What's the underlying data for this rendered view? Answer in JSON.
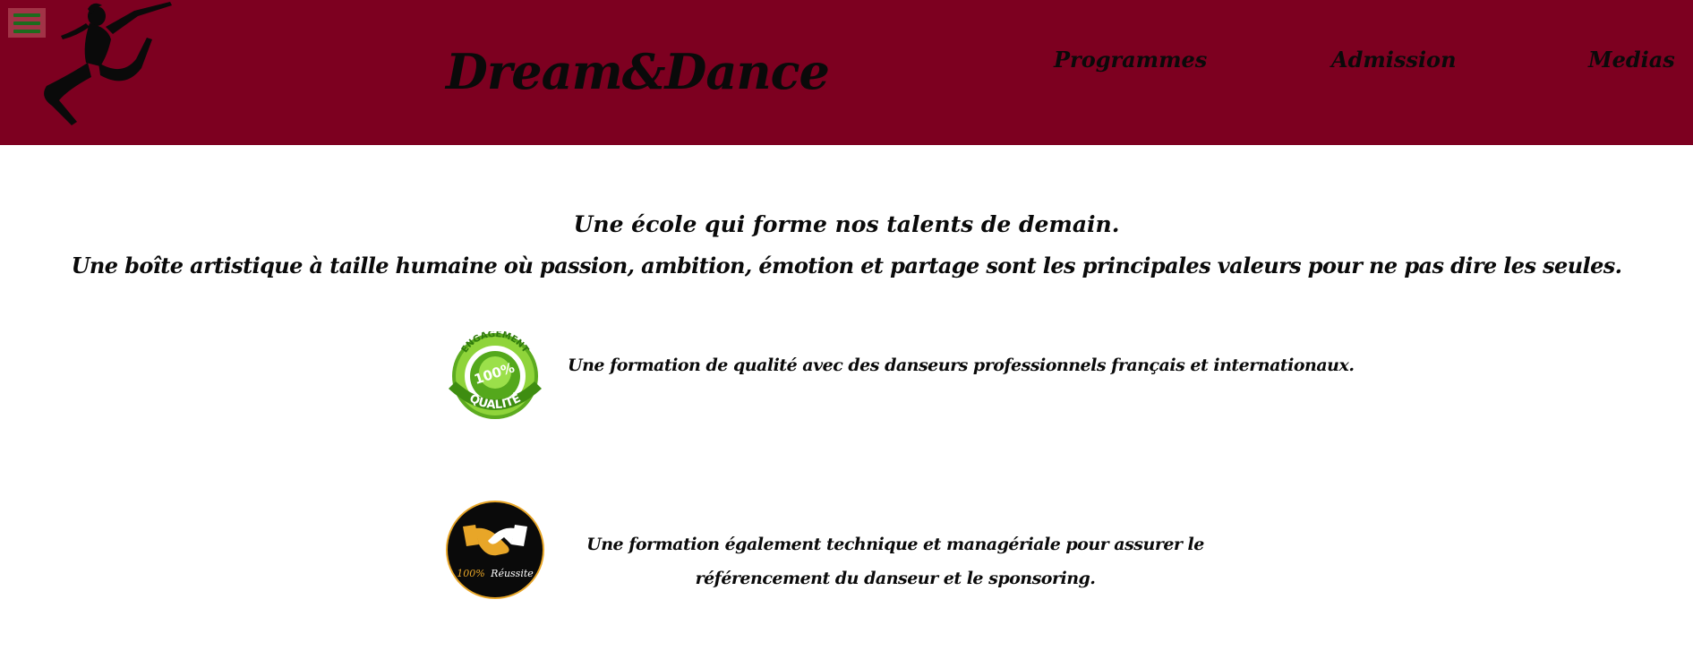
{
  "header": {
    "brand": "Dream&Dance",
    "menu_icon": "hamburger-icon",
    "logo_icon": "dancer-silhouette-icon",
    "nav": [
      "Programmes",
      "Admission",
      "Medias"
    ],
    "colors": {
      "background": "#7d0020",
      "menu_button": "#a23347",
      "menu_bars": "#1d6b1d"
    }
  },
  "intro": {
    "line1": "Une école qui forme nos talents de demain.",
    "line2": "Une boîte artistique à taille humaine où passion, ambition, émotion et partage sont les principales valeurs pour ne pas dire les seules."
  },
  "features": [
    {
      "icon": "quality-badge-icon",
      "badge_top": "ENGAGEMENT",
      "badge_center": "100%",
      "badge_bottom": "QUALITÉ",
      "text": "Une formation de qualité avec des danseurs professionnels français et internationaux."
    },
    {
      "icon": "handshake-badge-icon",
      "badge_caption_number": "100%",
      "badge_caption_word": "Réussite",
      "text": "Une formation également technique et managériale pour assurer le référencement du danseur et le sponsoring."
    }
  ]
}
